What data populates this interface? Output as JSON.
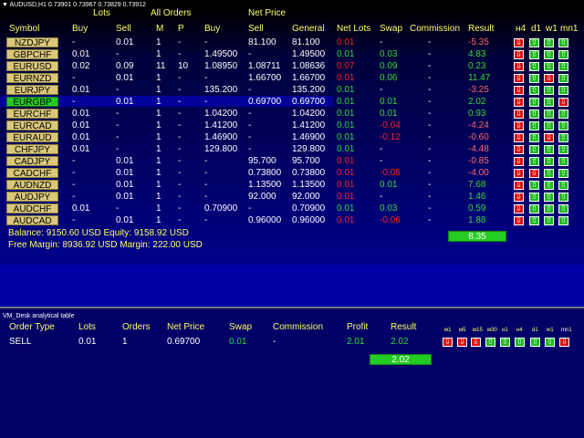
{
  "chart_title": "▼ AUDUSD,H1  0.73901 0.73967 0.73829 0.73912",
  "headers_top": {
    "lots": "Lots",
    "all_orders": "All Orders",
    "net_price": "Net Price"
  },
  "headers": {
    "symbol": "Symbol",
    "buy": "Buy",
    "sell": "Sell",
    "m": "M",
    "p": "P",
    "np_buy": "Buy",
    "np_sell": "Sell",
    "general": "General",
    "net_lots": "Net Lots",
    "swap": "Swap",
    "commission": "Commission",
    "result": "Result",
    "tf": [
      "н4",
      "d1",
      "w1",
      "mn1"
    ]
  },
  "rows": [
    {
      "symbol": "NZDJPY",
      "buy": "-",
      "sell": "0.01",
      "m": "1",
      "p": "-",
      "np_buy": "-",
      "np_sell": "81.100",
      "general": "81.100",
      "net_lots": "0.01",
      "net_color": "red",
      "swap": "-",
      "swap_color": "white",
      "commission": "-",
      "result": "-5.35",
      "result_color": "pink",
      "arrows": [
        "down",
        "up",
        "up",
        "up"
      ]
    },
    {
      "symbol": "GBPCHF",
      "buy": "0.01",
      "sell": "-",
      "m": "1",
      "p": "-",
      "np_buy": "1.49500",
      "np_sell": "-",
      "general": "1.49500",
      "net_lots": "0.01",
      "net_color": "green",
      "swap": "0.03",
      "swap_color": "green",
      "commission": "-",
      "result": "4.83",
      "result_color": "green",
      "arrows": [
        "down",
        "up",
        "up",
        "up"
      ]
    },
    {
      "symbol": "EURUSD",
      "buy": "0.02",
      "sell": "0.09",
      "m": "11",
      "p": "10",
      "np_buy": "1.08950",
      "np_sell": "1.08711",
      "general": "1.08636",
      "net_lots": "0.07",
      "net_color": "red",
      "swap": "0.09",
      "swap_color": "green",
      "commission": "-",
      "result": "0.23",
      "result_color": "green",
      "arrows": [
        "down",
        "up",
        "up",
        "up"
      ]
    },
    {
      "symbol": "EURNZD",
      "buy": "-",
      "sell": "0.01",
      "m": "1",
      "p": "-",
      "np_buy": "-",
      "np_sell": "1.66700",
      "general": "1.66700",
      "net_lots": "0.01",
      "net_color": "red",
      "swap": "0.06",
      "swap_color": "green",
      "commission": "-",
      "result": "11.47",
      "result_color": "green",
      "arrows": [
        "down",
        "up",
        "down",
        "up"
      ]
    },
    {
      "symbol": "EURJPY",
      "buy": "0.01",
      "sell": "-",
      "m": "1",
      "p": "-",
      "np_buy": "135.200",
      "np_sell": "-",
      "general": "135.200",
      "net_lots": "0.01",
      "net_color": "green",
      "swap": "-",
      "swap_color": "white",
      "commission": "-",
      "result": "-3.25",
      "result_color": "pink",
      "arrows": [
        "down",
        "up",
        "up",
        "up"
      ]
    },
    {
      "symbol": "EURGBP",
      "buy": "-",
      "sell": "0.01",
      "m": "1",
      "p": "-",
      "np_buy": "-",
      "np_sell": "0.69700",
      "general": "0.69700",
      "net_lots": "0.01",
      "net_color": "green",
      "swap": "0.01",
      "swap_color": "green",
      "commission": "-",
      "result": "2.02",
      "result_color": "green",
      "arrows": [
        "down",
        "up",
        "up",
        "down"
      ],
      "active": true
    },
    {
      "symbol": "EURCHF",
      "buy": "0.01",
      "sell": "-",
      "m": "1",
      "p": "-",
      "np_buy": "1.04200",
      "np_sell": "-",
      "general": "1.04200",
      "net_lots": "0.01",
      "net_color": "green",
      "swap": "0.01",
      "swap_color": "green",
      "commission": "-",
      "result": "0.93",
      "result_color": "green",
      "arrows": [
        "down",
        "up",
        "up",
        "up"
      ]
    },
    {
      "symbol": "EURCAD",
      "buy": "0.01",
      "sell": "-",
      "m": "1",
      "p": "-",
      "np_buy": "1.41200",
      "np_sell": "-",
      "general": "1.41200",
      "net_lots": "0.01",
      "net_color": "green",
      "swap": "-0.04",
      "swap_color": "red",
      "commission": "-",
      "result": "-4.24",
      "result_color": "pink",
      "arrows": [
        "down",
        "up",
        "up",
        "up"
      ]
    },
    {
      "symbol": "EURAUD",
      "buy": "0.01",
      "sell": "-",
      "m": "1",
      "p": "-",
      "np_buy": "1.46900",
      "np_sell": "-",
      "general": "1.46900",
      "net_lots": "0.01",
      "net_color": "green",
      "swap": "-0.12",
      "swap_color": "red",
      "commission": "-",
      "result": "-0.60",
      "result_color": "pink",
      "arrows": [
        "down",
        "up",
        "down",
        "up"
      ]
    },
    {
      "symbol": "CHFJPY",
      "buy": "0.01",
      "sell": "-",
      "m": "1",
      "p": "-",
      "np_buy": "129.800",
      "np_sell": "-",
      "general": "129.800",
      "net_lots": "0.01",
      "net_color": "green",
      "swap": "-",
      "swap_color": "white",
      "commission": "-",
      "result": "-4.48",
      "result_color": "pink",
      "arrows": [
        "down",
        "up",
        "up",
        "up"
      ]
    },
    {
      "symbol": "CADJPY",
      "buy": "-",
      "sell": "0.01",
      "m": "1",
      "p": "-",
      "np_buy": "-",
      "np_sell": "95.700",
      "general": "95.700",
      "net_lots": "0.01",
      "net_color": "red",
      "swap": "-",
      "swap_color": "white",
      "commission": "-",
      "result": "-0.85",
      "result_color": "pink",
      "arrows": [
        "down",
        "up",
        "up",
        "up"
      ]
    },
    {
      "symbol": "CADCHF",
      "buy": "-",
      "sell": "0.01",
      "m": "1",
      "p": "-",
      "np_buy": "-",
      "np_sell": "0.73800",
      "general": "0.73800",
      "net_lots": "0.01",
      "net_color": "red",
      "swap": "-0.05",
      "swap_color": "red",
      "commission": "-",
      "result": "-4.00",
      "result_color": "pink",
      "arrows": [
        "down",
        "down",
        "up",
        "up"
      ]
    },
    {
      "symbol": "AUDNZD",
      "buy": "-",
      "sell": "0.01",
      "m": "1",
      "p": "-",
      "np_buy": "-",
      "np_sell": "1.13500",
      "general": "1.13500",
      "net_lots": "0.01",
      "net_color": "red",
      "swap": "0.01",
      "swap_color": "green",
      "commission": "-",
      "result": "7.68",
      "result_color": "green",
      "arrows": [
        "down",
        "up",
        "up",
        "up"
      ]
    },
    {
      "symbol": "AUDJPY",
      "buy": "-",
      "sell": "0.01",
      "m": "1",
      "p": "-",
      "np_buy": "-",
      "np_sell": "92.000",
      "general": "92.000",
      "net_lots": "0.01",
      "net_color": "red",
      "swap": "-",
      "swap_color": "white",
      "commission": "-",
      "result": "1.46",
      "result_color": "green",
      "arrows": [
        "down",
        "up",
        "up",
        "up"
      ]
    },
    {
      "symbol": "AUDCHF",
      "buy": "0.01",
      "sell": "-",
      "m": "1",
      "p": "-",
      "np_buy": "0.70900",
      "np_sell": "-",
      "general": "0.70900",
      "net_lots": "0.01",
      "net_color": "green",
      "swap": "0.03",
      "swap_color": "green",
      "commission": "-",
      "result": "0.59",
      "result_color": "green",
      "arrows": [
        "down",
        "up",
        "up",
        "up"
      ]
    },
    {
      "symbol": "AUDCAD",
      "buy": "-",
      "sell": "0.01",
      "m": "1",
      "p": "-",
      "np_buy": "-",
      "np_sell": "0.96000",
      "general": "0.96000",
      "net_lots": "0.01",
      "net_color": "red",
      "swap": "-0.06",
      "swap_color": "red",
      "commission": "-",
      "result": "1.88",
      "result_color": "green",
      "arrows": [
        "down",
        "up",
        "up",
        "up"
      ]
    }
  ],
  "total_result": "8.35",
  "balance_line": "Balance: 9150.60 USD Equity: 9158.92 USD",
  "margin_line": "Free Margin: 8936.92 USD Margin: 222.00 USD",
  "panel": {
    "title": "VM_Desk analytical table",
    "headers": {
      "order_type": "Order Type",
      "lots": "Lots",
      "orders": "Orders",
      "net_price": "Net Price",
      "swap": "Swap",
      "commission": "Commission",
      "profit": "Profit",
      "result": "Result"
    },
    "tf": [
      "м1",
      "м5",
      "м15",
      "м30",
      "н1",
      "н4",
      "d1",
      "w1",
      "mn1"
    ],
    "row": {
      "order_type": "SELL",
      "lots": "0.01",
      "orders": "1",
      "net_price": "0.69700",
      "swap": "0.01",
      "commission": "-",
      "profit": "2.01",
      "result": "2.02"
    },
    "arrows": [
      "down",
      "down",
      "down",
      "up",
      "up",
      "up",
      "up",
      "up",
      "down"
    ],
    "total": "2.02"
  }
}
